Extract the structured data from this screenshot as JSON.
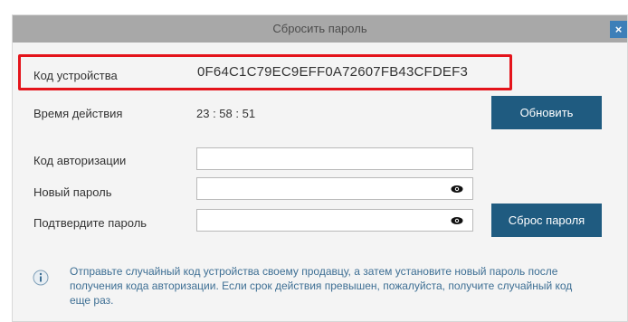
{
  "dialog": {
    "title": "Сбросить пароль",
    "close_icon": "close-icon"
  },
  "device": {
    "label": "Код устройства",
    "code": "0F64C1C79EC9EFF0A72607FB43CFDEF3"
  },
  "validity": {
    "label": "Время действия",
    "time": "23 : 58 : 51",
    "refresh_label": "Обновить"
  },
  "form": {
    "auth_code_label": "Код авторизации",
    "auth_code_value": "",
    "new_password_label": "Новый пароль",
    "new_password_value": "",
    "confirm_password_label": "Подтвердите пароль",
    "confirm_password_value": "",
    "reset_label": "Сброс пароля",
    "visibility_icon": "eye-icon"
  },
  "info": {
    "icon": "info-icon",
    "text": "Отправьте случайный код устройства своему продавцу, а затем установите новый пароль после получения кода авторизации. Если срок действия превышен, пожалуйста, получите случайный код еще раз."
  },
  "colors": {
    "accent": "#1f5b80",
    "highlight": "#e4141b",
    "info_text": "#3e6f94"
  }
}
